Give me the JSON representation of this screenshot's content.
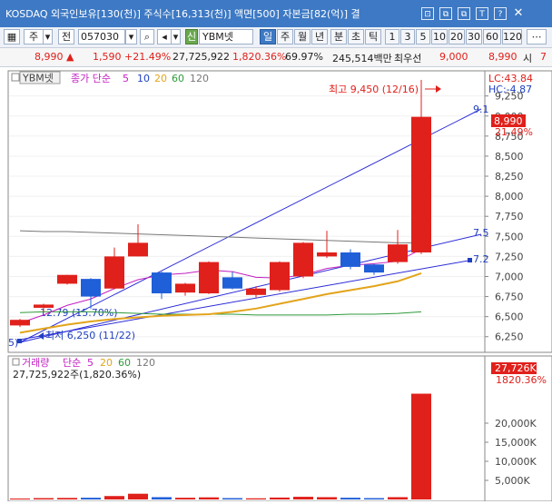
{
  "window": {
    "title": "KOSDAQ 외국인보유[130(천)] 주식수[16,313(천)] 액면[500] 자본금[82(억)] 결",
    "buttons": [
      "⊡",
      "⧉",
      "⧉",
      "T",
      "?",
      "✕"
    ]
  },
  "toolbar": {
    "market": "주",
    "prev": "전",
    "code": "057030",
    "stock_name": "YBM넷",
    "stock_tag": "신",
    "periods": [
      "일",
      "주",
      "월",
      "년",
      "분",
      "초",
      "틱"
    ],
    "active_period": "일",
    "intervals": [
      "1",
      "3",
      "5",
      "10",
      "20",
      "30",
      "60",
      "120"
    ]
  },
  "quote": {
    "price": "8,990",
    "change_arrow": "▲",
    "change": "1,590",
    "change_pct": "+21.49%",
    "volume": "27,725,922",
    "volume_ratio": "1,820.36%",
    "rate": "69.97%",
    "amount": "245,514백만",
    "bid_label": "최우선",
    "bid": "9,000",
    "open_price": "8,990",
    "open_label": "시",
    "extra": "7"
  },
  "chart": {
    "name_tag": "YBM넷",
    "legend_label": "종가 단순",
    "ma_periods": [
      "5",
      "10",
      "20",
      "60",
      "120"
    ],
    "ma_colors": [
      "#c21fc2",
      "#1f3fbf",
      "#e3a41b",
      "#2e9a3a",
      "#777777"
    ],
    "lc": "LC:43.84",
    "hc": "HC:-4.87",
    "price_ticks": [
      "9,250",
      "9,000",
      "8,750",
      "8,500",
      "8,250",
      "8,000",
      "7,750",
      "7,500",
      "7,250",
      "7,000",
      "6,750",
      "6,500",
      "6,250"
    ],
    "price_box": "8,990",
    "price_box_pct": "21.49%",
    "high_label": "최고 9,450 (12/16)",
    "low_label": "최저 6,250 (11/22)",
    "trend_label1": "12.79 (15.70%)",
    "right_labels": [
      "9.1",
      "7.5",
      "7.2"
    ],
    "left_edge_label": "5)",
    "chart_data": {
      "type": "candlestick",
      "candles": [
        {
          "o": 6390,
          "c": 6460,
          "h": 6470,
          "l": 6370
        },
        {
          "o": 6610,
          "c": 6650,
          "h": 6660,
          "l": 6560
        },
        {
          "o": 6910,
          "c": 7020,
          "h": 7020,
          "l": 6900
        },
        {
          "o": 6970,
          "c": 6750,
          "h": 6980,
          "l": 6600
        },
        {
          "o": 6850,
          "c": 7250,
          "h": 7360,
          "l": 6840
        },
        {
          "o": 7250,
          "c": 7420,
          "h": 7650,
          "l": 7250
        },
        {
          "o": 7050,
          "c": 6790,
          "h": 7060,
          "l": 6720
        },
        {
          "o": 6800,
          "c": 6910,
          "h": 6920,
          "l": 6760
        },
        {
          "o": 6790,
          "c": 7180,
          "h": 7190,
          "l": 6780
        },
        {
          "o": 6990,
          "c": 6850,
          "h": 7060,
          "l": 6840
        },
        {
          "o": 6770,
          "c": 6850,
          "h": 6880,
          "l": 6740
        },
        {
          "o": 6830,
          "c": 7180,
          "h": 7190,
          "l": 6810
        },
        {
          "o": 7000,
          "c": 7420,
          "h": 7430,
          "l": 6980
        },
        {
          "o": 7250,
          "c": 7300,
          "h": 7570,
          "l": 7230
        },
        {
          "o": 7300,
          "c": 7120,
          "h": 7340,
          "l": 7090
        },
        {
          "o": 7150,
          "c": 7050,
          "h": 7160,
          "l": 7020
        },
        {
          "o": 7180,
          "c": 7400,
          "h": 7580,
          "l": 7160
        },
        {
          "o": 7300,
          "c": 8990,
          "h": 9450,
          "l": 7280
        }
      ],
      "ma5": [
        6420,
        6520,
        6640,
        6720,
        6850,
        6960,
        7020,
        7040,
        7080,
        7060,
        6990,
        6980,
        7020,
        7100,
        7140,
        7160,
        7190,
        7340
      ],
      "ma20": [
        6300,
        6350,
        6400,
        6440,
        6470,
        6490,
        6510,
        6520,
        6530,
        6560,
        6600,
        6660,
        6720,
        6780,
        6830,
        6880,
        6940,
        7040
      ],
      "ma60": [
        6550,
        6560,
        6560,
        6560,
        6550,
        6540,
        6530,
        6530,
        6530,
        6530,
        6520,
        6520,
        6520,
        6520,
        6530,
        6530,
        6540,
        6560
      ],
      "ma120": [
        7570,
        7560,
        7560,
        7550,
        7540,
        7530,
        7520,
        7510,
        7500,
        7490,
        7480,
        7470,
        7460,
        7450,
        7440,
        7430,
        7420,
        7420
      ],
      "volume": [
        0.25,
        0.35,
        0.4,
        0.45,
        0.9,
        1.5,
        0.6,
        0.45,
        0.55,
        0.35,
        0.3,
        0.5,
        0.7,
        0.6,
        0.45,
        0.35,
        0.6,
        27.73
      ],
      "ylim": [
        6100,
        9450
      ]
    }
  },
  "volume_pane": {
    "legend_label": "거래량",
    "ma_label": "단순",
    "ma_periods": [
      "5",
      "20",
      "60",
      "120"
    ],
    "value_line": "27,725,922주(1,820.36%)",
    "ticks": [
      "20,000K",
      "15,000K",
      "10,000K",
      "5,000K"
    ],
    "box": "27,726K",
    "box_pct": "1820.36%"
  }
}
